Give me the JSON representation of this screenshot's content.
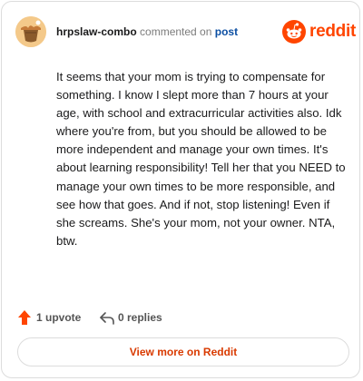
{
  "header": {
    "username": "hrpslaw-combo",
    "action_text": "commented on",
    "post_link": "post",
    "brand": "reddit",
    "avatar_icon": "avatar-icon",
    "logo_icon": "reddit-logo-icon"
  },
  "comment": {
    "body": "It seems that your mom is trying to compensate for something. I know I slept more than 7 hours at your age, with school and extracurricular activities also. Idk where you're from, but you should be allowed to be more independent and manage your own times. It's about learning responsibility! Tell her that you NEED to manage your own times to be more responsible, and see how that goes. And if not, stop listening! Even if she screams. She's your mom, not your owner. NTA, btw."
  },
  "footer": {
    "upvote_label": "1 upvote",
    "replies_label": "0 replies",
    "upvote_icon": "upvote-arrow-icon",
    "reply_icon": "reply-arrow-icon"
  },
  "view_more": {
    "label": "View more on Reddit"
  },
  "colors": {
    "brand": "#ff4500",
    "link": "#0b4ea2",
    "view_more_text": "#d93a00",
    "border": "#dcdcdc"
  }
}
